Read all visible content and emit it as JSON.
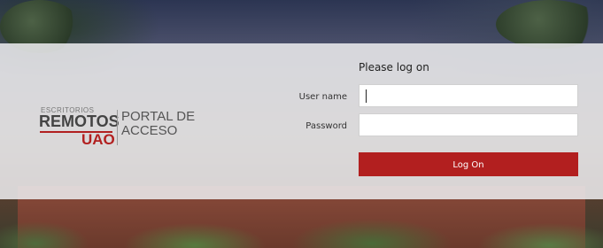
{
  "logo": {
    "small_text": "ESCRITORIOS",
    "main_text": "REMOTOS",
    "accent_text": "UAO",
    "portal_line1": "PORTAL DE",
    "portal_line2": "ACCESO"
  },
  "form": {
    "title": "Please log on",
    "username_label": "User name",
    "username_value": "",
    "password_label": "Password",
    "password_value": "",
    "submit_label": "Log On"
  },
  "colors": {
    "accent": "#b21f1f",
    "panel": "#ececee"
  }
}
